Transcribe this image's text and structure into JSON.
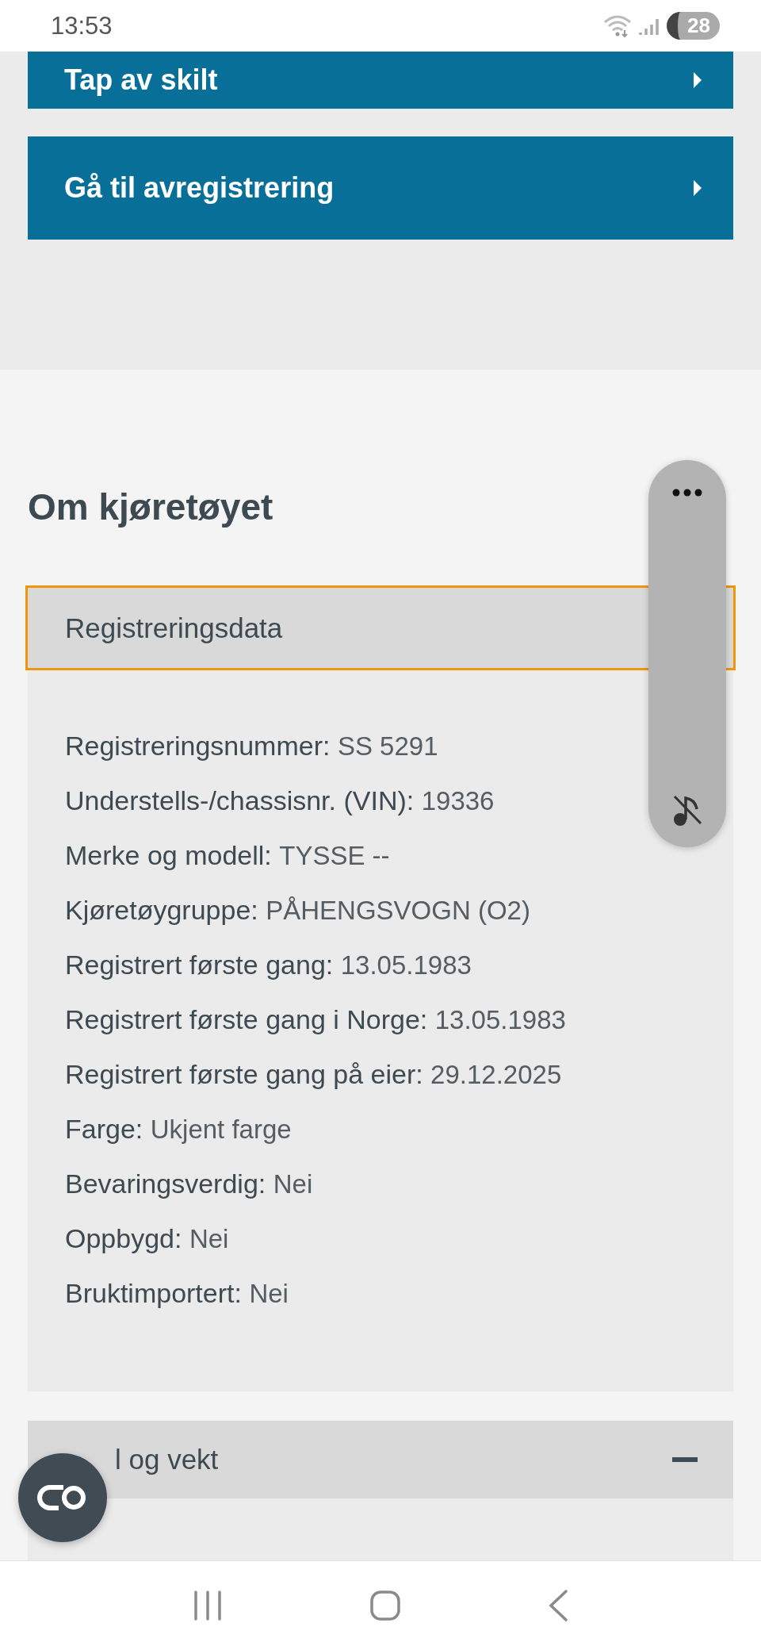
{
  "status_bar": {
    "time": "13:53",
    "battery": "28"
  },
  "action_buttons": [
    {
      "label": "Tap av skilt"
    },
    {
      "label": "Gå til avregistrering"
    }
  ],
  "section": {
    "title": "Om kjøretøyet"
  },
  "accordions": [
    {
      "title": "Registreringsdata",
      "expanded": true,
      "focused": true,
      "fields": [
        {
          "label": "Registreringsnummer:",
          "value": "SS 5291"
        },
        {
          "label": "Understells-/chassisnr. (VIN):",
          "value": "19336"
        },
        {
          "label": "Merke og modell:",
          "value": "TYSSE --"
        },
        {
          "label": "Kjøretøygruppe:",
          "value": "PÅHENGSVOGN (O2)"
        },
        {
          "label": "Registrert første gang:",
          "value": "13.05.1983"
        },
        {
          "label": "Registrert første gang i Norge:",
          "value": "13.05.1983"
        },
        {
          "label": "Registrert første gang på eier:",
          "value": "29.12.2025"
        },
        {
          "label": "Farge:",
          "value": "Ukjent farge"
        },
        {
          "label": "Bevaringsverdig:",
          "value": "Nei"
        },
        {
          "label": "Oppbygd:",
          "value": "Nei"
        },
        {
          "label": "Bruktimportert:",
          "value": "Nei"
        }
      ]
    },
    {
      "title": "l og vekt",
      "expanded": true,
      "focused": false,
      "show_toggle": true
    }
  ]
}
